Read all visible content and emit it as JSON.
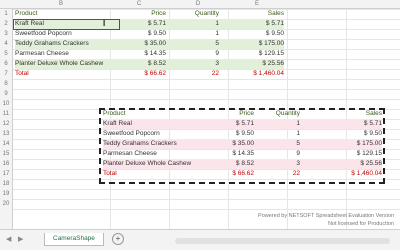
{
  "columns": [
    "B",
    "C",
    "D",
    "E"
  ],
  "row_numbers": [
    "1",
    "2",
    "3",
    "4",
    "5",
    "6",
    "7",
    "8",
    "9",
    "10",
    "11",
    "12",
    "13",
    "14",
    "15",
    "16",
    "17",
    "18",
    "19",
    "20"
  ],
  "top_table": {
    "headers": [
      "Product",
      "Price",
      "Quantity",
      "Sales"
    ],
    "rows": [
      [
        "Kraft Real",
        "$ 5.71",
        "1",
        "$ 5.71"
      ],
      [
        "Sweetfood Popcorn",
        "$ 9.50",
        "1",
        "$ 9.50"
      ],
      [
        "Teddy Grahams Crackers",
        "$ 35.00",
        "5",
        "$ 175.00"
      ],
      [
        "Parmesan Cheese",
        "$ 14.35",
        "9",
        "$ 129.15"
      ],
      [
        "Planter Deluxe Whole Cashew",
        "$ 8.52",
        "3",
        "$ 25.56"
      ]
    ],
    "total": [
      "Total",
      "$ 66.62",
      "22",
      "$ 1,460.04"
    ]
  },
  "bottom_table": {
    "headers": [
      "Product",
      "Price",
      "Quantity",
      "Sales"
    ],
    "rows": [
      [
        "Kraft Real",
        "$ 5.71",
        "1",
        "$ 5.71"
      ],
      [
        "Sweetfood Popcorn",
        "$ 9.50",
        "1",
        "$ 9.50"
      ],
      [
        "Teddy Grahams Crackers",
        "$ 35.00",
        "5",
        "$ 175.00"
      ],
      [
        "Parmesan Cheese",
        "$ 14.35",
        "9",
        "$ 129.15"
      ],
      [
        "Planter Deluxe Whole Cashew",
        "$ 8.52",
        "3",
        "$ 25.56"
      ]
    ],
    "total": [
      "Total",
      "$ 66.62",
      "22",
      "$ 1,460.04"
    ]
  },
  "editing_value": "Kraft Real",
  "sheet_tab": "CameraShape",
  "watermark": {
    "line1": "Powered by NETSOFT Spreadsheet Evaluation Version",
    "line2": "Not licensed for Production"
  },
  "colors": {
    "accent": "#1e7145",
    "header_text": "#3a5a1a",
    "total_red": "#c00000",
    "row_green": "#e2efd9",
    "row_pink": "#fbe4ea"
  }
}
